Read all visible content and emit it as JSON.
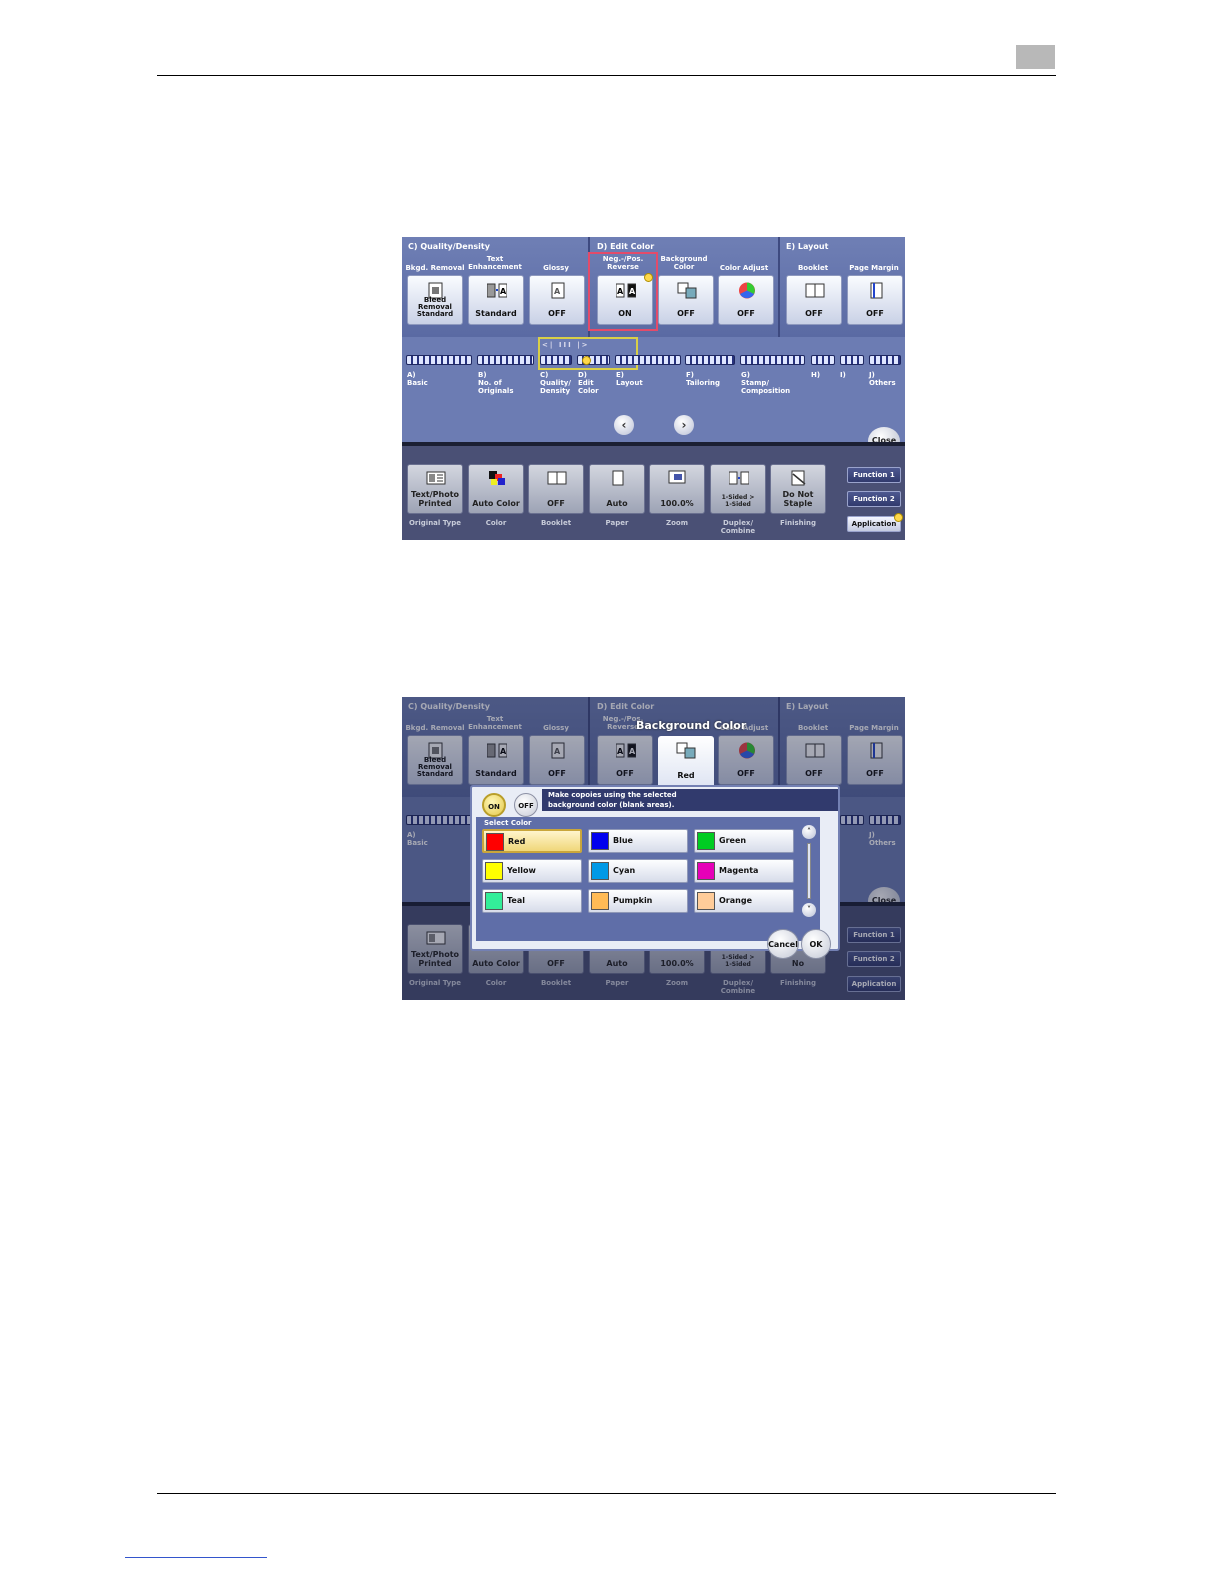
{
  "screen_top": {
    "groups": {
      "quality": "C)   Quality/Density",
      "edit_color": "D)   Edit Color",
      "layout": "E)   Layout"
    },
    "columns": [
      {
        "label": "Bkgd. Removal",
        "value": "Bleed\nRemoval\nStandard",
        "icon": "bkgd-removal-icon"
      },
      {
        "label": "Text\nEnhancement",
        "value": "Standard",
        "icon": "text-enhancement-icon"
      },
      {
        "label": "Glossy",
        "value": "OFF",
        "icon": "glossy-icon"
      },
      {
        "label": "Neg.-/Pos.\nReverse",
        "value": "ON",
        "icon": "neg-pos-reverse-icon"
      },
      {
        "label": "Background\nColor",
        "value": "OFF",
        "icon": "background-color-icon"
      },
      {
        "label": "Color Adjust",
        "value": "OFF",
        "icon": "color-adjust-icon"
      },
      {
        "label": "Booklet",
        "value": "OFF",
        "icon": "booklet-icon"
      },
      {
        "label": "Page Margin",
        "value": "OFF",
        "icon": "page-margin-icon"
      }
    ],
    "tabs": [
      {
        "label": "A)\nBasic"
      },
      {
        "label": "B)\nNo. of\nOriginals"
      },
      {
        "label": "C)\nQuality/\nDensity"
      },
      {
        "label": "D)\nEdit\nColor"
      },
      {
        "label": "E)\nLayout"
      },
      {
        "label": "F)\nTailoring"
      },
      {
        "label": "G)\nStamp/\nComposition"
      },
      {
        "label": "H)"
      },
      {
        "label": "I)"
      },
      {
        "label": "J)\nOthers"
      }
    ],
    "slider_indicator": "<|          III          |>",
    "close": "Close"
  },
  "quick_bar": {
    "items": [
      {
        "value": "Text/Photo\nPrinted",
        "label": "Original Type",
        "icon": "original-type-icon"
      },
      {
        "value": "Auto Color",
        "label": "Color",
        "icon": "color-icon"
      },
      {
        "value": "OFF",
        "label": "Booklet",
        "icon": "booklet-icon"
      },
      {
        "value": "Auto",
        "label": "Paper",
        "icon": "paper-icon"
      },
      {
        "value": "100.0%",
        "label": "Zoom",
        "icon": "zoom-icon"
      },
      {
        "value": "1-Sided >\n1-Sided",
        "label": "Duplex/\nCombine",
        "icon": "duplex-icon"
      },
      {
        "value": "Do Not\nStaple",
        "label": "Finishing",
        "icon": "finishing-icon"
      }
    ],
    "side_buttons": [
      "Function 1",
      "Function 2",
      "Application"
    ]
  },
  "dialog": {
    "title": "Background Color",
    "tab_value": "Red",
    "on": "ON",
    "off": "OFF",
    "message": "Make copoies using the selected\nbackground color (blank areas).",
    "select_label": "Select Color",
    "colors": [
      {
        "name": "Red",
        "swatch": "#ff0000"
      },
      {
        "name": "Blue",
        "swatch": "#0000ee"
      },
      {
        "name": "Green",
        "swatch": "#00cc22"
      },
      {
        "name": "Yellow",
        "swatch": "#ffff00"
      },
      {
        "name": "Cyan",
        "swatch": "#0099e6"
      },
      {
        "name": "Magenta",
        "swatch": "#e600b8"
      },
      {
        "name": "Teal",
        "swatch": "#33ee99"
      },
      {
        "name": "Pumpkin",
        "swatch": "#ffbb55"
      },
      {
        "name": "Orange",
        "swatch": "#ffcc99"
      }
    ],
    "selected": "Red",
    "cancel": "Cancel",
    "ok": "OK",
    "under_labels": [
      "A)\nBasic",
      "J)\nOthers",
      "No"
    ]
  }
}
